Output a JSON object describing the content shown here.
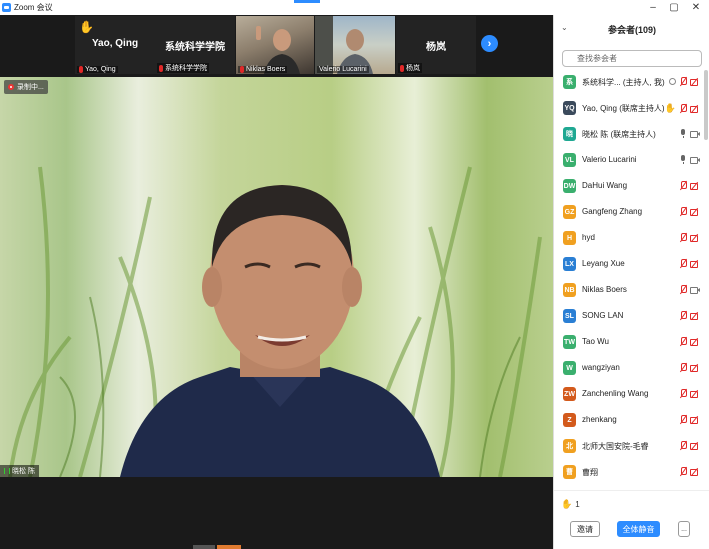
{
  "window": {
    "title": "Zoom 会议",
    "controls": {
      "minimize": "–",
      "restore": "▢",
      "close": "✕"
    }
  },
  "strip": {
    "tiles": [
      {
        "center_name": "Yao, Qing",
        "label": "Yao, Qing",
        "raised_hand": true
      },
      {
        "center_name": "系统科学学院",
        "label": "系统科学学院"
      },
      {
        "label": "Niklas Boers"
      },
      {
        "label": "Valerio Lucarini"
      },
      {
        "center_name": "杨岚",
        "label": "杨岚"
      }
    ],
    "next_arrow": "›"
  },
  "main_video": {
    "recording_label": "录制中...",
    "speaker_label": "晓松 陈"
  },
  "panel": {
    "title": "参会者(109)",
    "collapse_glyph": "⌄",
    "search_placeholder": "查找参会者",
    "participants": [
      {
        "initials": "系",
        "color": "#3aaf6e",
        "name": "系统科学... (主持人, 我)",
        "icons": [
          "share",
          "mic-muted",
          "cam-off"
        ]
      },
      {
        "initials": "YQ",
        "color": "#3b4a5c",
        "name": "Yao, Qing (联席主持人)",
        "icons": [
          "hand",
          "mic-muted",
          "cam-off"
        ]
      },
      {
        "initials": "晓",
        "color": "#1fa892",
        "name": "晓松 陈 (联席主持人)",
        "icons": [
          "mic-on",
          "cam-on"
        ]
      },
      {
        "initials": "VL",
        "color": "#3aaf6e",
        "name": "Valerio Lucarini",
        "icons": [
          "mic-on",
          "cam-on"
        ]
      },
      {
        "initials": "DW",
        "color": "#3aaf6e",
        "name": "DaHui Wang",
        "icons": [
          "mic-muted",
          "cam-off"
        ]
      },
      {
        "initials": "GZ",
        "color": "#f0a020",
        "name": "Gangfeng Zhang",
        "icons": [
          "mic-muted",
          "cam-off"
        ]
      },
      {
        "initials": "H",
        "color": "#f0a020",
        "name": "hyd",
        "icons": [
          "mic-muted",
          "cam-off"
        ]
      },
      {
        "initials": "LX",
        "color": "#2a7fd4",
        "name": "Leyang Xue",
        "icons": [
          "mic-muted",
          "cam-off"
        ]
      },
      {
        "initials": "NB",
        "color": "#f0a020",
        "name": "Niklas Boers",
        "icons": [
          "mic-muted",
          "cam-on"
        ]
      },
      {
        "initials": "SL",
        "color": "#2a7fd4",
        "name": "SONG LAN",
        "icons": [
          "mic-muted",
          "cam-off"
        ]
      },
      {
        "initials": "TW",
        "color": "#3aaf6e",
        "name": "Tao  Wu",
        "icons": [
          "mic-muted",
          "cam-off"
        ]
      },
      {
        "initials": "W",
        "color": "#3aaf6e",
        "name": "wangziyan",
        "icons": [
          "mic-muted",
          "cam-off"
        ]
      },
      {
        "initials": "ZW",
        "color": "#d35a1c",
        "name": "Zanchenling Wang",
        "icons": [
          "mic-muted",
          "cam-off"
        ]
      },
      {
        "initials": "Z",
        "color": "#d35a1c",
        "name": "zhenkang",
        "icons": [
          "mic-muted",
          "cam-off"
        ]
      },
      {
        "initials": "北",
        "color": "#f0a020",
        "name": "北师大国安院-毛睿",
        "icons": [
          "mic-muted",
          "cam-off"
        ]
      },
      {
        "initials": "曹",
        "color": "#f0a020",
        "name": "曹翔",
        "icons": [
          "mic-muted",
          "cam-off"
        ]
      }
    ],
    "raised_hands_count": "1",
    "invite_label": "邀请",
    "mute_all_label": "全体静音",
    "more_label": "..."
  }
}
